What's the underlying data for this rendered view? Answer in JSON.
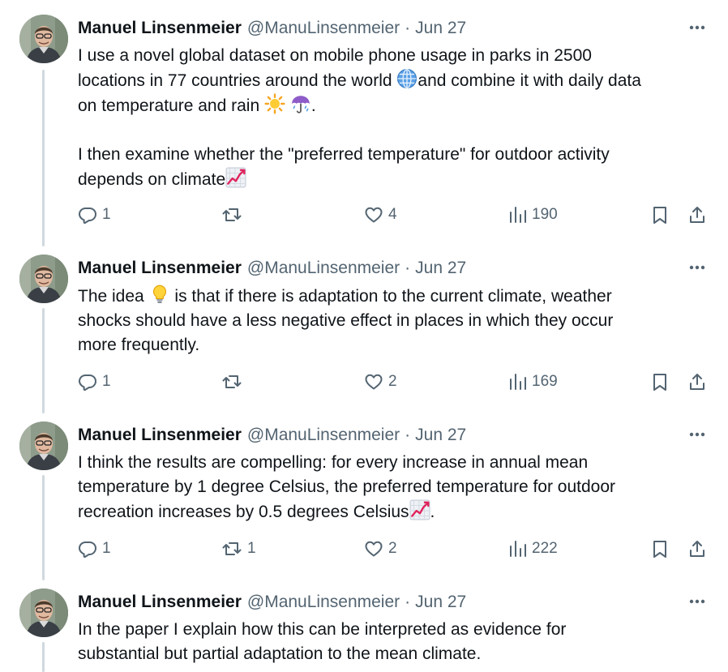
{
  "author": {
    "name": "Manuel Linsenmeier",
    "handle": "@ManuLinsenmeier",
    "separator": "·"
  },
  "colors": {
    "text": "#0f1419",
    "secondary": "#536471",
    "thread_line": "#cfd9de"
  },
  "icons": [
    "more-icon",
    "reply-icon",
    "retweet-icon",
    "like-icon",
    "views-icon",
    "bookmark-icon",
    "share-icon"
  ],
  "tweets": [
    {
      "date": "Jun 27",
      "text": {
        "l1": "I use a novel global dataset on mobile phone usage in parks in 2500",
        "l2a": "locations in 77 countries around the world ",
        "l2b": "and combine it with daily data",
        "l3a": "on temperature and rain ",
        "l3b": ".",
        "l5": "I then examine whether the \"preferred temperature\" for outdoor activity",
        "l6": "depends on climate"
      },
      "emojis": [
        "globe-emoji",
        "sun-emoji",
        "umbrella-rain-emoji",
        "chart-increasing-emoji"
      ],
      "replies": "1",
      "retweets": "",
      "likes": "4",
      "views": "190"
    },
    {
      "date": "Jun 27",
      "text": {
        "l1a": "The idea ",
        "l1b": " is that if there is adaptation to the current climate, weather",
        "l2": "shocks should have a less negative effect in places in which they occur",
        "l3": "more frequently."
      },
      "emojis": [
        "lightbulb-emoji"
      ],
      "replies": "1",
      "retweets": "",
      "likes": "2",
      "views": "169"
    },
    {
      "date": "Jun 27",
      "text": {
        "l1": "I think the results are compelling: for every increase in annual mean",
        "l2": "temperature by 1 degree Celsius, the preferred temperature for outdoor",
        "l3a": "recreation increases by 0.5 degrees Celsius",
        "l3b": "."
      },
      "emojis": [
        "chart-increasing-emoji"
      ],
      "replies": "1",
      "retweets": "1",
      "likes": "2",
      "views": "222"
    },
    {
      "date": "Jun 27",
      "text": {
        "l1": "In the paper I explain how this can be interpreted as evidence for",
        "l2": "substantial but partial adaptation to the mean climate."
      },
      "emojis": [],
      "replies": "",
      "retweets": "",
      "likes": "",
      "views": ""
    }
  ]
}
